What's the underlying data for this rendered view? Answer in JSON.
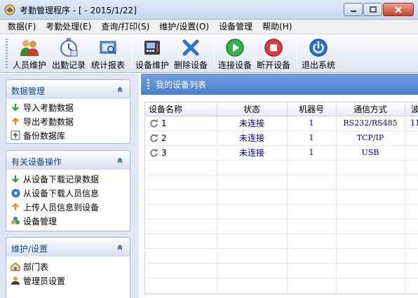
{
  "window": {
    "title": "考勤管理程序 - [ - 2015/1/22]"
  },
  "menu": [
    "数据(F)",
    "考勤处理(E)",
    "查询/打印(S)",
    "维护/设置(O)",
    "设备管理",
    "帮助(H)"
  ],
  "toolbar": {
    "staff": "人员维护",
    "attendance": "出勤记录",
    "report": "统计报表",
    "device_maint": "设备维护",
    "delete_device": "删除设备",
    "connect": "连接设备",
    "disconnect": "断开设备",
    "exit": "退出系统"
  },
  "sidebar": {
    "data_mgmt": {
      "title": "数据管理",
      "items": [
        "导入考勤数据",
        "导出考勤数据",
        "备份数据库"
      ]
    },
    "device_ops": {
      "title": "有关设备操作",
      "items": [
        "从设备下载记录数据",
        "从设备下载人员信息",
        "上传人员信息到设备",
        "设备管理"
      ]
    },
    "maintenance": {
      "title": "维护/设置",
      "items": [
        "部门表",
        "管理员设置"
      ]
    }
  },
  "device_list": {
    "title": "我的设备列表",
    "columns": [
      "设备名称",
      "状态",
      "机器号",
      "通信方式",
      "波"
    ],
    "rows": [
      {
        "name": "1",
        "status": "未连接",
        "machine": "1",
        "comm": "RS232/RS485",
        "baud": "11"
      },
      {
        "name": "2",
        "status": "未连接",
        "machine": "1",
        "comm": "TCP/IP",
        "baud": ""
      },
      {
        "name": "3",
        "status": "未连接",
        "machine": "1",
        "comm": "USB",
        "baud": ""
      }
    ]
  },
  "colors": {
    "header_blue": "#4d82cf",
    "status_text": "#0000b0",
    "section_title": "#15428b"
  }
}
